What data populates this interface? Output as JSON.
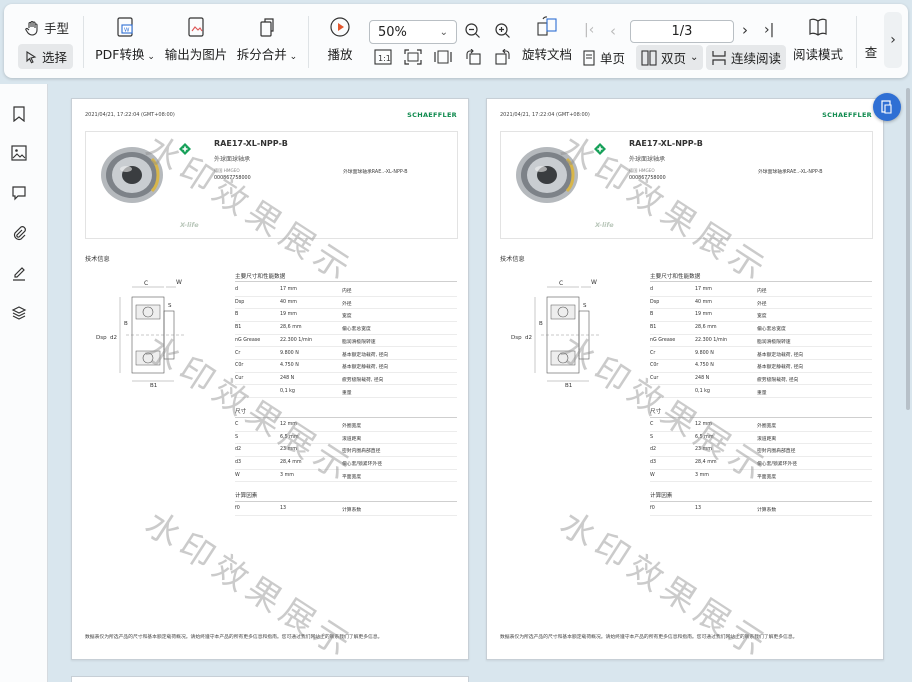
{
  "toolbar": {
    "hand_label": "手型",
    "select_label": "选择",
    "pdf_convert_label": "PDF转换",
    "export_image_label": "输出为图片",
    "split_merge_label": "拆分合并",
    "play_label": "播放",
    "zoom_value": "50%",
    "rotate_label": "旋转文档",
    "single_page_label": "单页",
    "double_page_label": "双页",
    "continuous_label": "连续阅读",
    "reading_mode_label": "阅读模式",
    "search_label": "查",
    "page_indicator": "1/3"
  },
  "sidebar": {
    "items": [
      "bookmark-icon",
      "image-icon",
      "comment-icon",
      "attachment-icon",
      "signature-icon",
      "layers-icon"
    ]
  },
  "document": {
    "timestamp": "2021/04/21, 17:22:04 (GMT+08:00)",
    "brand": "SCHAEFFLER",
    "product_title": "RAE17-XL-NPP-B",
    "product_subtitle": "外球面球轴承",
    "product_label": "德国 HMGEO",
    "product_number": "000867758000",
    "product_mid": "外球面球轴承RAE..-XL-NPP-B",
    "xlife": "X-life",
    "tech_info": "技术信息",
    "diagram_labels": {
      "c": "C",
      "w": "W",
      "dsp": "Dsp",
      "d2": "d2",
      "b": "B",
      "b1": "B1",
      "s": "S"
    },
    "section_main": "主要尺寸和性能数据",
    "rows_main": [
      {
        "sym": "d",
        "val": "17 mm",
        "desc": "内径"
      },
      {
        "sym": "Dsp",
        "val": "40 mm",
        "desc": "外径"
      },
      {
        "sym": "B",
        "val": "19 mm",
        "desc": "宽度"
      },
      {
        "sym": "B1",
        "val": "28,6 mm",
        "desc": "偏心套总宽度"
      },
      {
        "sym": "nG Grease",
        "val": "22.300 1/min",
        "desc": "脂润滑极限转速"
      },
      {
        "sym": "Cr",
        "val": "9.800 N",
        "desc": "基本额定动载荷, 径向"
      },
      {
        "sym": "C0r",
        "val": "4.750 N",
        "desc": "基本额定静载荷, 径向"
      },
      {
        "sym": "Cur",
        "val": "248 N",
        "desc": "疲劳极限载荷, 径向"
      },
      {
        "sym": "",
        "val": "0,1 kg",
        "desc": "重量"
      }
    ],
    "section_dim": "尺寸",
    "rows_dim": [
      {
        "sym": "C",
        "val": "12 mm",
        "desc": "外圈宽度"
      },
      {
        "sym": "S",
        "val": "6,5 mm",
        "desc": "滚道距离"
      },
      {
        "sym": "d2",
        "val": "23 mm",
        "desc": "密封内圈肩部直径"
      },
      {
        "sym": "d3",
        "val": "28,4 mm",
        "desc": "偏心套/锁紧环外径"
      },
      {
        "sym": "W",
        "val": "3 mm",
        "desc": "平面宽度"
      }
    ],
    "section_calc": "计算因素",
    "rows_calc": [
      {
        "sym": "f0",
        "val": "13",
        "desc": "计算系数"
      }
    ],
    "footer": "数据表仅为所选产品的尺寸和基本额定载荷概况。请始终遵守本产品的所有更多信息和指南。您可通过我们网站上的联系我们了解更多信息。",
    "watermark": "水印效果展示"
  },
  "colors": {
    "brand_green": "#0f8a4e",
    "accent_blue": "#2f6fd4"
  }
}
